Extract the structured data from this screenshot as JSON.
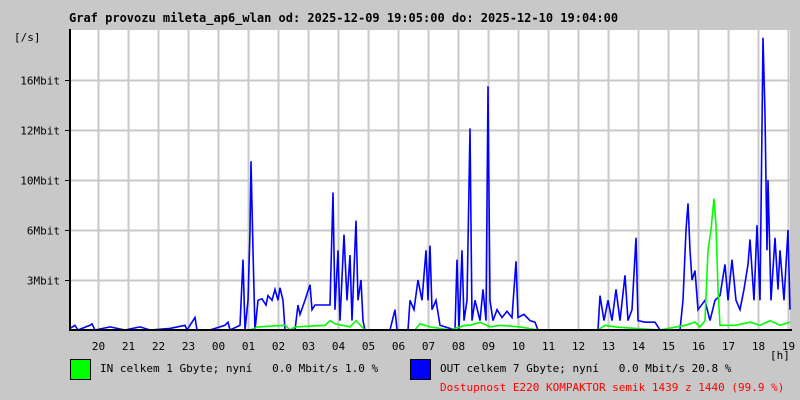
{
  "chart_data": {
    "type": "line",
    "title": "Graf provozu mileta_ap6_wlan od: 2025-12-09 19:05:00 do: 2025-12-10 19:04:00",
    "ylabel": "[/s]",
    "xlabel": "[h]",
    "x_unit": "minutes since 2025-12-09 19:04",
    "xlim": [
      0,
      1440
    ],
    "ylim": [
      0,
      19.2
    ],
    "grid": true,
    "y_ticks": [
      {
        "value": 3.2,
        "label": "3Mbit"
      },
      {
        "value": 6.4,
        "label": "6Mbit"
      },
      {
        "value": 9.6,
        "label": "10Mbit"
      },
      {
        "value": 12.8,
        "label": "12Mbit"
      },
      {
        "value": 16,
        "label": "16Mbit"
      }
    ],
    "x_ticks": [
      {
        "value": 56,
        "label": "20"
      },
      {
        "value": 116,
        "label": "21"
      },
      {
        "value": 176,
        "label": "22"
      },
      {
        "value": 236,
        "label": "23"
      },
      {
        "value": 296,
        "label": "00"
      },
      {
        "value": 356,
        "label": "01"
      },
      {
        "value": 416,
        "label": "02"
      },
      {
        "value": 476,
        "label": "03"
      },
      {
        "value": 536,
        "label": "04"
      },
      {
        "value": 596,
        "label": "05"
      },
      {
        "value": 656,
        "label": "06"
      },
      {
        "value": 716,
        "label": "07"
      },
      {
        "value": 776,
        "label": "08"
      },
      {
        "value": 836,
        "label": "09"
      },
      {
        "value": 896,
        "label": "10"
      },
      {
        "value": 956,
        "label": "11"
      },
      {
        "value": 1016,
        "label": "12"
      },
      {
        "value": 1076,
        "label": "13"
      },
      {
        "value": 1136,
        "label": "14"
      },
      {
        "value": 1196,
        "label": "15"
      },
      {
        "value": 1256,
        "label": "16"
      },
      {
        "value": 1316,
        "label": "17"
      },
      {
        "value": 1376,
        "label": "18"
      },
      {
        "value": 1436,
        "label": "19"
      }
    ],
    "series": [
      {
        "name": "OUT",
        "color": "#0000ff",
        "points": [
          [
            0,
            0.1
          ],
          [
            10,
            0.3
          ],
          [
            16,
            0
          ],
          [
            40,
            0.3
          ],
          [
            44,
            0.4
          ],
          [
            50,
            0
          ],
          [
            80,
            0.2
          ],
          [
            110,
            0
          ],
          [
            140,
            0.2
          ],
          [
            160,
            0
          ],
          [
            200,
            0.1
          ],
          [
            230,
            0.3
          ],
          [
            234,
            0
          ],
          [
            250,
            0.8
          ],
          [
            254,
            0
          ],
          [
            280,
            0
          ],
          [
            310,
            0.3
          ],
          [
            316,
            0.5
          ],
          [
            320,
            0
          ],
          [
            340,
            0.3
          ],
          [
            346,
            4.5
          ],
          [
            350,
            0
          ],
          [
            356,
            1.9
          ],
          [
            360,
            6.3
          ],
          [
            362,
            10.8
          ],
          [
            366,
            5.1
          ],
          [
            370,
            0
          ],
          [
            376,
            1.9
          ],
          [
            384,
            2.0
          ],
          [
            392,
            1.6
          ],
          [
            396,
            2.2
          ],
          [
            404,
            1.9
          ],
          [
            410,
            2.6
          ],
          [
            416,
            1.9
          ],
          [
            420,
            2.7
          ],
          [
            426,
            1.9
          ],
          [
            430,
            0
          ],
          [
            450,
            0
          ],
          [
            456,
            1.6
          ],
          [
            460,
            1.0
          ],
          [
            470,
            1.9
          ],
          [
            480,
            2.9
          ],
          [
            484,
            1.3
          ],
          [
            490,
            1.6
          ],
          [
            500,
            1.6
          ],
          [
            510,
            1.6
          ],
          [
            520,
            1.6
          ],
          [
            526,
            8.8
          ],
          [
            530,
            1.3
          ],
          [
            536,
            5.1
          ],
          [
            540,
            0.6
          ],
          [
            548,
            6.1
          ],
          [
            554,
            1.9
          ],
          [
            560,
            4.8
          ],
          [
            564,
            0.6
          ],
          [
            572,
            7.0
          ],
          [
            576,
            1.9
          ],
          [
            582,
            3.2
          ],
          [
            586,
            0.6
          ],
          [
            590,
            0
          ],
          [
            640,
            0
          ],
          [
            650,
            1.3
          ],
          [
            654,
            0
          ],
          [
            676,
            0
          ],
          [
            680,
            1.9
          ],
          [
            688,
            1.3
          ],
          [
            696,
            3.2
          ],
          [
            704,
            1.9
          ],
          [
            712,
            5.1
          ],
          [
            716,
            1.9
          ],
          [
            720,
            5.4
          ],
          [
            724,
            1.3
          ],
          [
            732,
            1.9
          ],
          [
            740,
            0.3
          ],
          [
            770,
            0
          ],
          [
            774,
            4.5
          ],
          [
            778,
            0
          ],
          [
            784,
            5.1
          ],
          [
            788,
            0.6
          ],
          [
            794,
            1.9
          ],
          [
            800,
            12.9
          ],
          [
            804,
            0.6
          ],
          [
            810,
            1.9
          ],
          [
            820,
            0.6
          ],
          [
            826,
            2.6
          ],
          [
            832,
            0.6
          ],
          [
            836,
            15.6
          ],
          [
            840,
            1.9
          ],
          [
            846,
            0.6
          ],
          [
            854,
            1.3
          ],
          [
            864,
            0.8
          ],
          [
            874,
            1.2
          ],
          [
            884,
            0.8
          ],
          [
            892,
            4.4
          ],
          [
            896,
            0.8
          ],
          [
            908,
            1.0
          ],
          [
            920,
            0.6
          ],
          [
            930,
            0.5
          ],
          [
            936,
            0
          ],
          [
            1056,
            0
          ],
          [
            1060,
            2.2
          ],
          [
            1068,
            0.6
          ],
          [
            1076,
            1.9
          ],
          [
            1084,
            0.6
          ],
          [
            1092,
            2.6
          ],
          [
            1100,
            0.6
          ],
          [
            1110,
            3.5
          ],
          [
            1116,
            0.6
          ],
          [
            1124,
            1.3
          ],
          [
            1132,
            5.9
          ],
          [
            1136,
            0.6
          ],
          [
            1150,
            0.5
          ],
          [
            1170,
            0.5
          ],
          [
            1180,
            0
          ],
          [
            1220,
            0
          ],
          [
            1226,
            1.9
          ],
          [
            1232,
            6.4
          ],
          [
            1236,
            8.1
          ],
          [
            1240,
            5.1
          ],
          [
            1244,
            3.2
          ],
          [
            1250,
            3.8
          ],
          [
            1256,
            1.3
          ],
          [
            1270,
            1.9
          ],
          [
            1280,
            0.6
          ],
          [
            1290,
            1.9
          ],
          [
            1300,
            2.2
          ],
          [
            1310,
            4.2
          ],
          [
            1316,
            1.9
          ],
          [
            1324,
            4.5
          ],
          [
            1332,
            1.9
          ],
          [
            1340,
            1.3
          ],
          [
            1348,
            2.6
          ],
          [
            1356,
            4.2
          ],
          [
            1360,
            5.8
          ],
          [
            1368,
            1.9
          ],
          [
            1374,
            6.7
          ],
          [
            1380,
            1.9
          ],
          [
            1386,
            18.7
          ],
          [
            1390,
            13.8
          ],
          [
            1394,
            5.1
          ],
          [
            1396,
            9.6
          ],
          [
            1402,
            1.9
          ],
          [
            1410,
            5.9
          ],
          [
            1416,
            2.6
          ],
          [
            1420,
            5.1
          ],
          [
            1428,
            1.9
          ],
          [
            1436,
            6.4
          ],
          [
            1440,
            1.3
          ]
        ]
      },
      {
        "name": "IN",
        "color": "#00ff00",
        "points": [
          [
            0,
            0
          ],
          [
            360,
            0
          ],
          [
            376,
            0.2
          ],
          [
            430,
            0.3
          ],
          [
            440,
            0
          ],
          [
            450,
            0.2
          ],
          [
            510,
            0.3
          ],
          [
            520,
            0.6
          ],
          [
            530,
            0.4
          ],
          [
            560,
            0.2
          ],
          [
            572,
            0.6
          ],
          [
            590,
            0
          ],
          [
            690,
            0
          ],
          [
            700,
            0.4
          ],
          [
            720,
            0.2
          ],
          [
            760,
            0
          ],
          [
            790,
            0.3
          ],
          [
            800,
            0.3
          ],
          [
            820,
            0.5
          ],
          [
            840,
            0.2
          ],
          [
            860,
            0.3
          ],
          [
            900,
            0.2
          ],
          [
            936,
            0
          ],
          [
            1056,
            0
          ],
          [
            1070,
            0.3
          ],
          [
            1090,
            0.2
          ],
          [
            1130,
            0.1
          ],
          [
            1180,
            0
          ],
          [
            1230,
            0.3
          ],
          [
            1250,
            0.5
          ],
          [
            1260,
            0.2
          ],
          [
            1270,
            0.6
          ],
          [
            1276,
            5.1
          ],
          [
            1282,
            6.4
          ],
          [
            1288,
            8.4
          ],
          [
            1292,
            6.7
          ],
          [
            1296,
            2.6
          ],
          [
            1300,
            0.3
          ],
          [
            1330,
            0.3
          ],
          [
            1360,
            0.5
          ],
          [
            1380,
            0.3
          ],
          [
            1400,
            0.6
          ],
          [
            1420,
            0.3
          ],
          [
            1440,
            0.5
          ]
        ]
      }
    ]
  },
  "legend": {
    "in": {
      "color": "#00ff00",
      "text": "IN celkem 1 Gbyte; nyní   0.0 Mbit/s 1.0 %"
    },
    "out": {
      "color": "#0000ff",
      "text": "OUT celkem 7 Gbyte; nyní   0.0 Mbit/s 20.8 %"
    },
    "availability": "Dostupnost E220 KOMPAKTOR semik 1439 z 1440 (99.9 %)"
  }
}
